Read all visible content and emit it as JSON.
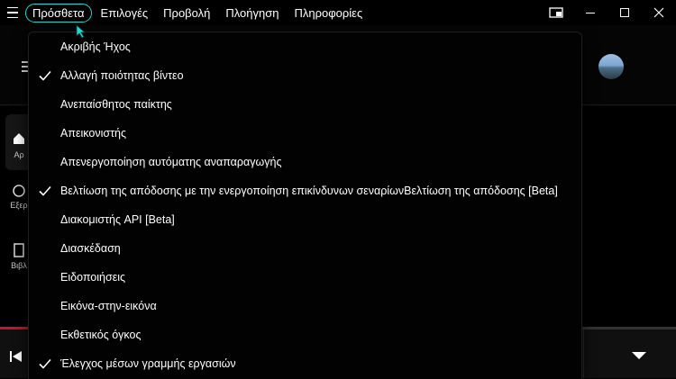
{
  "menubar": {
    "items": [
      {
        "label": "Πρόσθετα",
        "active": true
      },
      {
        "label": "Επιλογές",
        "active": false
      },
      {
        "label": "Προβολή",
        "active": false
      },
      {
        "label": "Πλοήγηση",
        "active": false
      },
      {
        "label": "Πληροφορίες",
        "active": false
      }
    ]
  },
  "window_controls": [
    "picture-in-picture-icon",
    "minimize-icon",
    "maximize-icon",
    "close-icon"
  ],
  "sidebar": {
    "items": [
      {
        "label": "Αρ"
      },
      {
        "label": "Εξερ"
      },
      {
        "label": "Βιβλ"
      }
    ]
  },
  "dropdown": {
    "items": [
      {
        "label": "Ακριβής Ήχος",
        "checked": false
      },
      {
        "label": "Αλλαγή ποιότητας βίντεο",
        "checked": true
      },
      {
        "label": "Ανεπαίσθητος παίκτης",
        "checked": false
      },
      {
        "label": "Απεικονιστής",
        "checked": false
      },
      {
        "label": "Απενεργοποίηση αυτόματης αναπαραγωγής",
        "checked": false
      },
      {
        "label": "Βελτίωση της απόδοσης με την ενεργοποίηση επικίνδυνων σεναρίωνΒελτίωση της απόδοσης [Beta]",
        "checked": true
      },
      {
        "label": "Διακομιστής API [Beta]",
        "checked": false
      },
      {
        "label": "Διασκέδαση",
        "checked": false
      },
      {
        "label": "Ειδοποιήσεις",
        "checked": false
      },
      {
        "label": "Εικόνα-στην-εικόνα",
        "checked": false
      },
      {
        "label": "Εκθετικός όγκος",
        "checked": false
      },
      {
        "label": "Έλεγχος μέσων γραμμής εργασιών",
        "checked": true
      }
    ]
  },
  "player": {
    "progress": 0.05
  },
  "colors": {
    "accent": "#26d6d0",
    "progress": "#d1102d",
    "background": "#000000"
  }
}
